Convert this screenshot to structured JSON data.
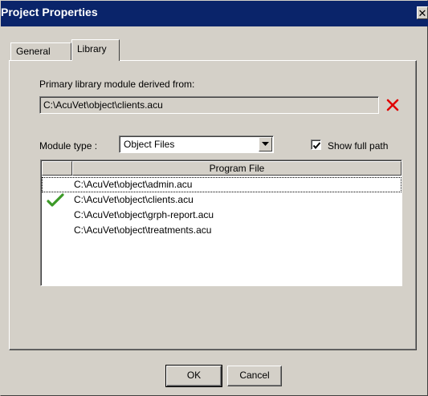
{
  "window": {
    "title": "Project Properties",
    "close_glyph": "✕"
  },
  "tabs": [
    {
      "label": "General",
      "active": false
    },
    {
      "label": "Library",
      "active": true
    }
  ],
  "library": {
    "primary_label": "Primary library module derived from:",
    "primary_value": "C:\\AcuVet\\object\\clients.acu",
    "clear_icon": "red-x-icon",
    "module_type_label": "Module type :",
    "module_type_value": "Object Files",
    "show_full_path_label": "Show full path",
    "show_full_path_checked": true,
    "columns": [
      "",
      "Program File"
    ],
    "files": [
      {
        "path": "C:\\AcuVet\\object\\admin.acu",
        "checked": false,
        "focused": true
      },
      {
        "path": "C:\\AcuVet\\object\\clients.acu",
        "checked": true,
        "focused": false
      },
      {
        "path": "C:\\AcuVet\\object\\grph-report.acu",
        "checked": false,
        "focused": false
      },
      {
        "path": "C:\\AcuVet\\object\\treatments.acu",
        "checked": false,
        "focused": false
      }
    ]
  },
  "buttons": {
    "ok_label": "OK",
    "cancel_label": "Cancel"
  },
  "colors": {
    "title_bar": "#0a246a",
    "face": "#d4d0c8",
    "clear_red": "#e00000",
    "check_green": "#3c9a28"
  }
}
